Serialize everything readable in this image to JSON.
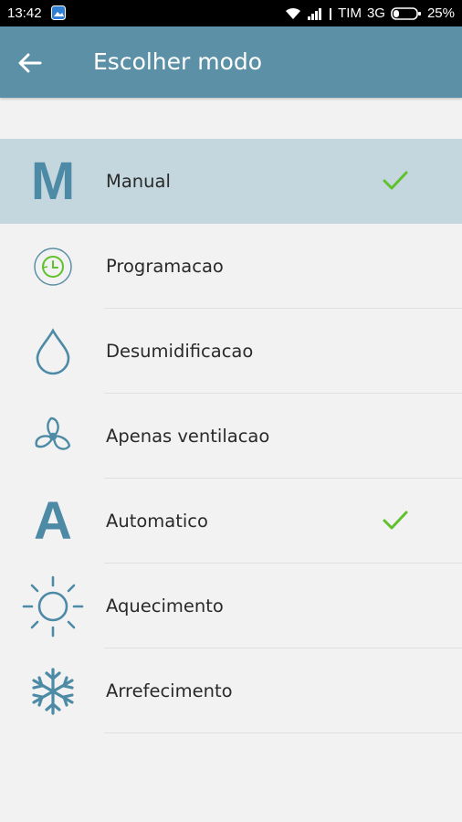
{
  "status_bar": {
    "time": "13:42",
    "carrier": "TIM",
    "network": "3G",
    "battery": "25%",
    "battery_level": 0.25
  },
  "app_bar": {
    "title": "Escolher modo",
    "back_icon": "arrow-left-icon"
  },
  "colors": {
    "app_bar": "#5c90a6",
    "icon": "#4d8aa5",
    "selected_row": "#c5d7de",
    "check": "#5fc12b",
    "background": "#f2f2f2"
  },
  "modes": [
    {
      "label": "Manual",
      "icon": "letter-m-icon",
      "selected": true,
      "checked": true
    },
    {
      "label": "Programacao",
      "icon": "clock-icon",
      "selected": false,
      "checked": false
    },
    {
      "label": "Desumidificacao",
      "icon": "water-drop-icon",
      "selected": false,
      "checked": false
    },
    {
      "label": "Apenas ventilacao",
      "icon": "fan-icon",
      "selected": false,
      "checked": false
    },
    {
      "label": "Automatico",
      "icon": "letter-a-icon",
      "selected": false,
      "checked": true
    },
    {
      "label": "Aquecimento",
      "icon": "sun-icon",
      "selected": false,
      "checked": false
    },
    {
      "label": "Arrefecimento",
      "icon": "snowflake-icon",
      "selected": false,
      "checked": false
    }
  ]
}
